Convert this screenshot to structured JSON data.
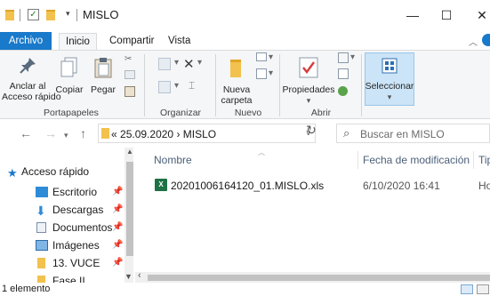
{
  "window": {
    "title": "MISLO",
    "controls": {
      "minimize": "—",
      "maximize": "☐",
      "close": "✕"
    }
  },
  "ribbon_tabs": [
    {
      "label": "Archivo"
    },
    {
      "label": "Inicio"
    },
    {
      "label": "Compartir"
    },
    {
      "label": "Vista"
    }
  ],
  "ribbon": {
    "pin_quick_access": "Anclar al\nAcceso rápido",
    "copy": "Copiar",
    "paste": "Pegar",
    "organize": "Organizar",
    "new_folder": "Nueva\ncarpeta",
    "properties": "Propiedades",
    "select": "Seleccionar",
    "groups": {
      "clipboard": "Portapapeles",
      "organize": "Organizar",
      "new": "Nuevo",
      "open": "Abrir"
    }
  },
  "address": {
    "path_prefix": "«",
    "path_parent": "25.09.2020",
    "path_separator": "›",
    "path_current": "MISLO",
    "search_placeholder": "Buscar en MISLO"
  },
  "nav_pane": {
    "items": [
      {
        "label": "Acceso rápido",
        "icon": "star-icon"
      },
      {
        "label": "Escritorio",
        "icon": "desktop-icon"
      },
      {
        "label": "Descargas",
        "icon": "download-icon"
      },
      {
        "label": "Documentos",
        "icon": "documents-icon"
      },
      {
        "label": "Imágenes",
        "icon": "pictures-icon"
      },
      {
        "label": "13. VUCE",
        "icon": "folder-icon"
      },
      {
        "label": "Fase II",
        "icon": "folder-icon"
      }
    ]
  },
  "columns": {
    "name": "Nombre",
    "modified": "Fecha de modificación",
    "type": "Tip"
  },
  "files": [
    {
      "name": "20201006164120_01.MISLO.xls",
      "modified": "6/10/2020 16:41",
      "type": "Ho"
    }
  ],
  "status": {
    "count": "1 elemento"
  },
  "colors": {
    "accent": "#1979ca",
    "folder": "#f2c14e",
    "excel": "#1e7145",
    "selected": "#cce4f7"
  }
}
